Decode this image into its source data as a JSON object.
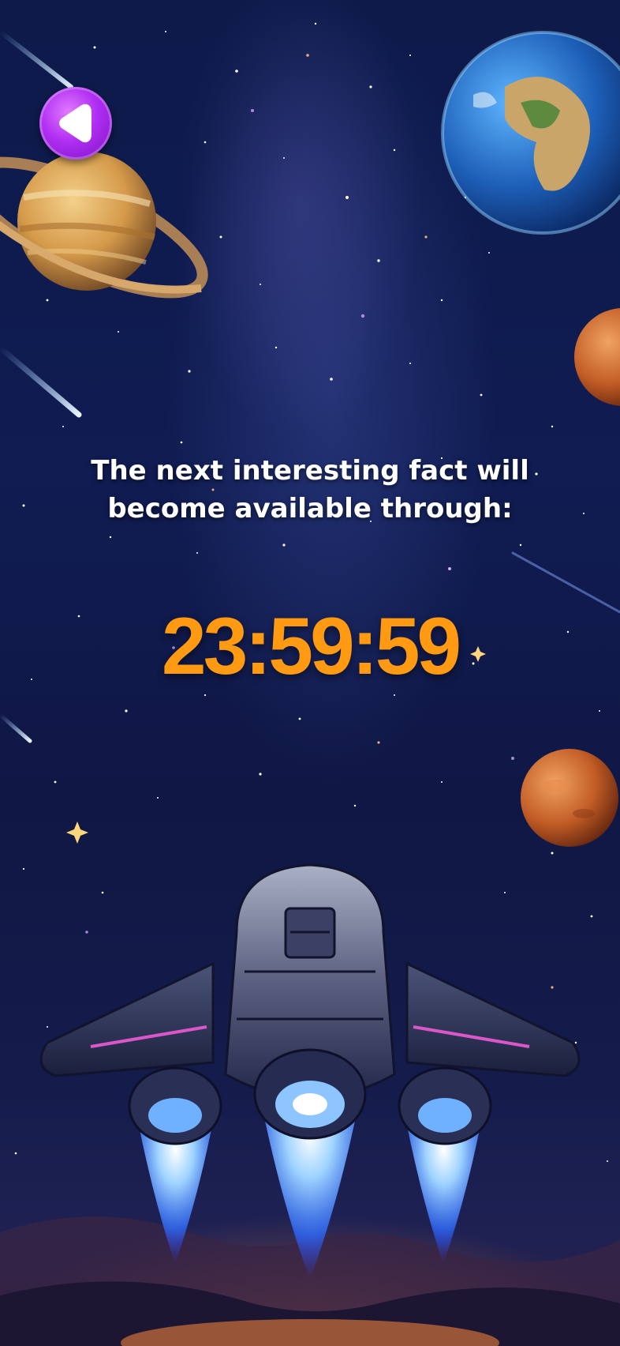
{
  "back_button": {
    "icon": "arrow-left-icon"
  },
  "message": {
    "text": "The next interesting fact will become available through:"
  },
  "timer": {
    "value": "23:59:59"
  },
  "scene": {
    "planets": [
      "saturn",
      "earth",
      "mars-small",
      "mars-large"
    ],
    "ship": "spaceship"
  },
  "colors": {
    "accent": "#ff9a12",
    "back_button": "#b02ef2",
    "sky": "#101c52"
  }
}
